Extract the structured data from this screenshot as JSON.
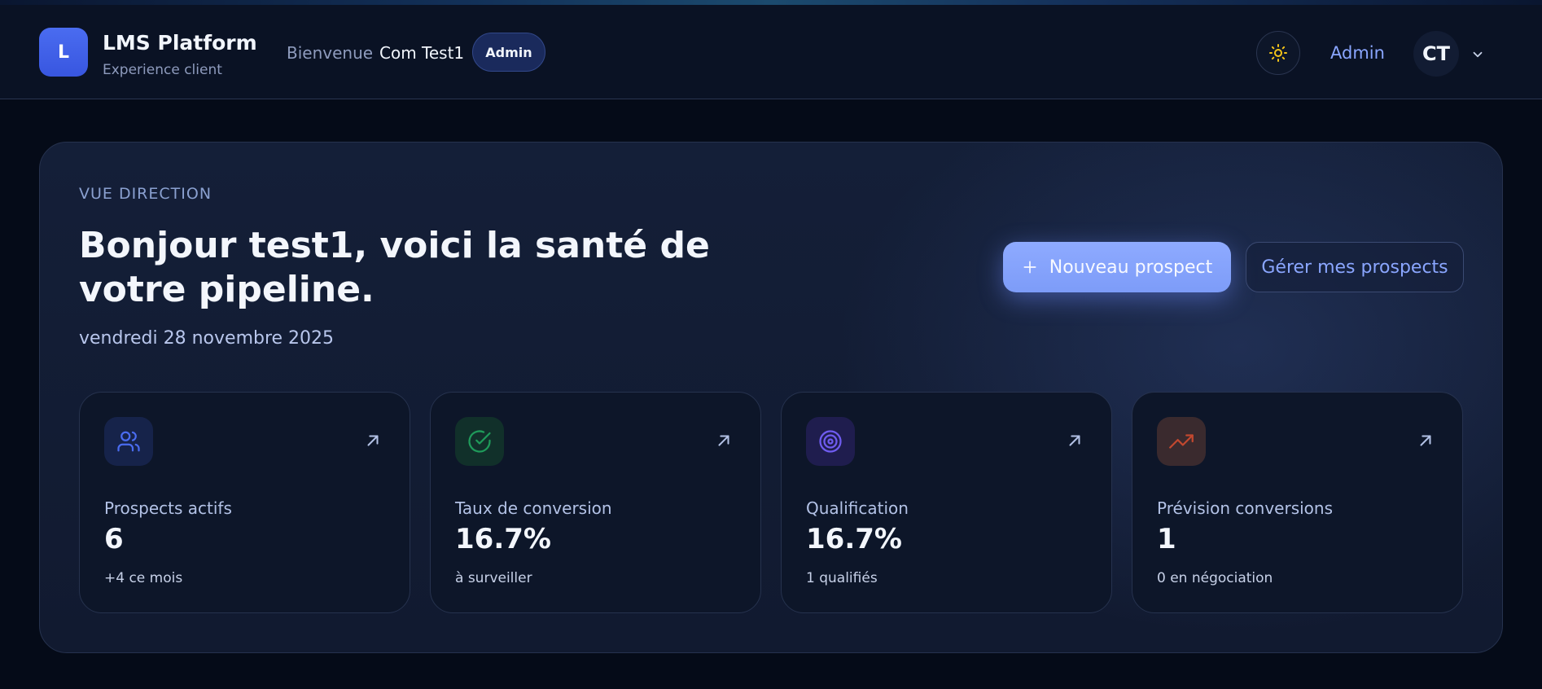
{
  "header": {
    "logo_letter": "L",
    "brand_title": "LMS Platform",
    "brand_subtitle": "Experience client",
    "welcome": "Bienvenue",
    "username": "Com Test1",
    "role_badge": "Admin",
    "admin_link": "Admin",
    "avatar_initials": "CT"
  },
  "hero": {
    "kicker": "VUE DIRECTION",
    "headline": "Bonjour test1, voici la santé de votre pipeline.",
    "date": "vendredi 28 novembre 2025",
    "primary_button": "Nouveau prospect",
    "secondary_button": "Gérer mes prospects"
  },
  "cards": [
    {
      "icon": "users-icon",
      "icon_color": "#4a6cf0",
      "icon_bg": "#16234a",
      "label": "Prospects actifs",
      "value": "6",
      "note": "+4 ce mois"
    },
    {
      "icon": "check-circle-icon",
      "icon_color": "#1f9a5a",
      "icon_bg": "#11302a",
      "label": "Taux de conversion",
      "value": "16.7%",
      "note": "à surveiller"
    },
    {
      "icon": "target-icon",
      "icon_color": "#6f5cf0",
      "icon_bg": "#1f1d4e",
      "label": "Qualification",
      "value": "16.7%",
      "note": "1 qualifiés"
    },
    {
      "icon": "trending-up-icon",
      "icon_color": "#c2482f",
      "icon_bg": "#3a2a2e",
      "label": "Prévision conversions",
      "value": "1",
      "note": "0 en négociation"
    }
  ],
  "colors": {
    "accent": "#8aa6ff",
    "primary_button": "#7d9cf8",
    "theme_icon": "#f5c518"
  }
}
